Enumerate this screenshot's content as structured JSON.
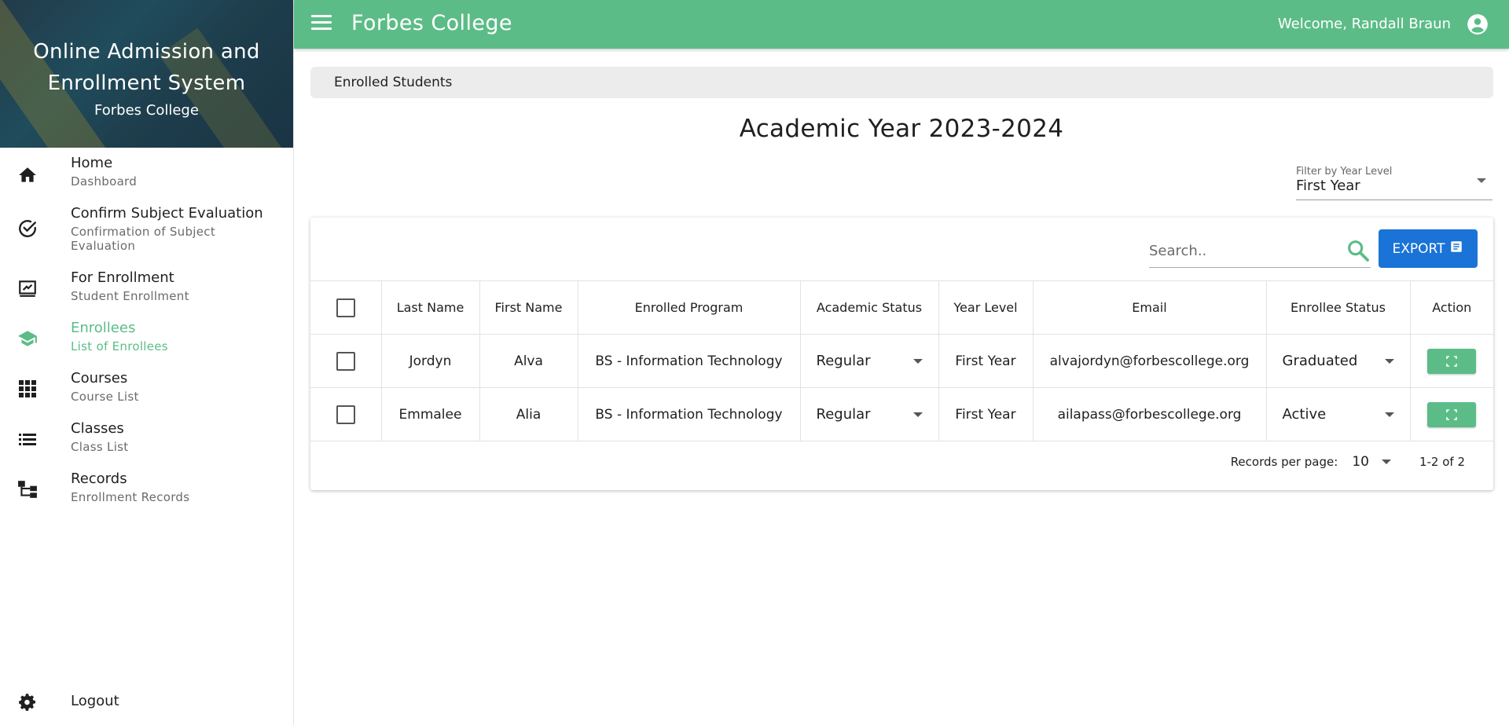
{
  "sidebar": {
    "brand_title": "Online Admission and Enrollment System",
    "brand_subtitle": "Forbes College",
    "items": [
      {
        "label": "Home",
        "sublabel": "Dashboard",
        "icon": "home-icon"
      },
      {
        "label": "Confirm Subject Evaluation",
        "sublabel": "Confirmation of Subject Evaluation",
        "icon": "check-circle-icon"
      },
      {
        "label": "For Enrollment",
        "sublabel": "Student Enrollment",
        "icon": "enrollment-icon"
      },
      {
        "label": "Enrollees",
        "sublabel": "List of Enrollees",
        "icon": "school-icon",
        "active": true
      },
      {
        "label": "Courses",
        "sublabel": "Course List",
        "icon": "grid-icon"
      },
      {
        "label": "Classes",
        "sublabel": "Class List",
        "icon": "list-icon"
      },
      {
        "label": "Records",
        "sublabel": "Enrollment Records",
        "icon": "records-icon"
      }
    ],
    "logout_label": "Logout"
  },
  "topbar": {
    "app_title": "Forbes College",
    "welcome": "Welcome, Randall Braun"
  },
  "breadcrumb": "Enrolled Students",
  "page_title": "Academic Year 2023-2024",
  "filter": {
    "label": "Filter by Year Level",
    "value": "First Year"
  },
  "toolbar": {
    "search_placeholder": "Search..",
    "export_label": "EXPORT"
  },
  "table": {
    "headers": [
      "Last Name",
      "First Name",
      "Enrolled Program",
      "Academic Status",
      "Year Level",
      "Email",
      "Enrollee Status",
      "Action"
    ],
    "rows": [
      {
        "last": "Jordyn",
        "first": "Alva",
        "program": "BS - Information Technology",
        "academic": "Regular",
        "year": "First Year",
        "email": "alvajordyn@forbescollege.org",
        "status": "Graduated"
      },
      {
        "last": "Emmalee",
        "first": "Alia",
        "program": "BS - Information Technology",
        "academic": "Regular",
        "year": "First Year",
        "email": "ailapass@forbescollege.org",
        "status": "Active"
      }
    ]
  },
  "pagination": {
    "label": "Records per page:",
    "per_page": "10",
    "range": "1-2 of 2"
  },
  "colors": {
    "accent": "#5cbc87",
    "export": "#1a73d6"
  }
}
